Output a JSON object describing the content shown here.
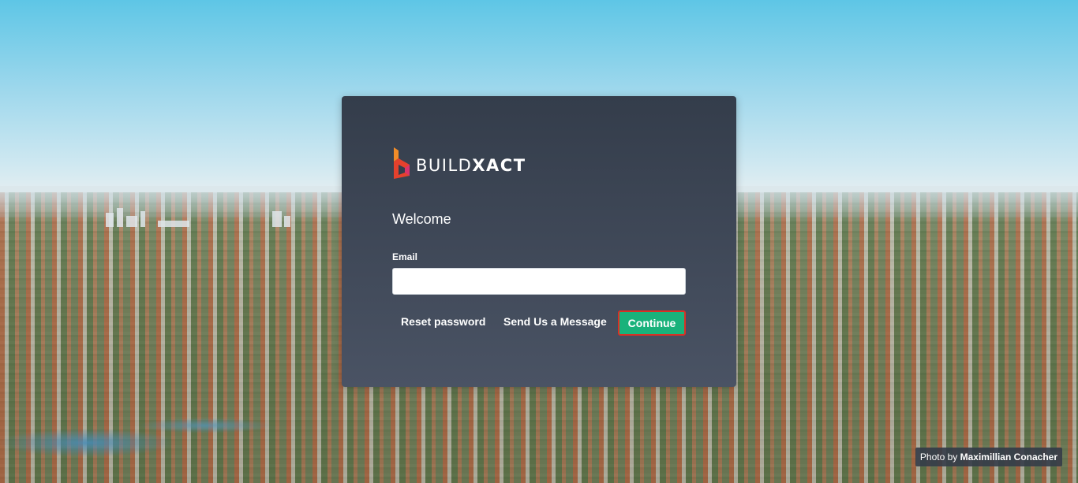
{
  "brand": {
    "name_light": "BUILD",
    "name_bold": "XACT",
    "colors": {
      "orange": "#f28c28",
      "red": "#e5412d",
      "pink": "#d9336b"
    }
  },
  "login": {
    "title": "Welcome",
    "email_label": "Email",
    "email_value": "",
    "email_placeholder": "",
    "reset_label": "Reset password",
    "message_label": "Send Us a Message",
    "continue_label": "Continue",
    "continue_color": "#19b27b"
  },
  "credit": {
    "prefix": "Photo by",
    "author": "Maximillian Conacher"
  }
}
